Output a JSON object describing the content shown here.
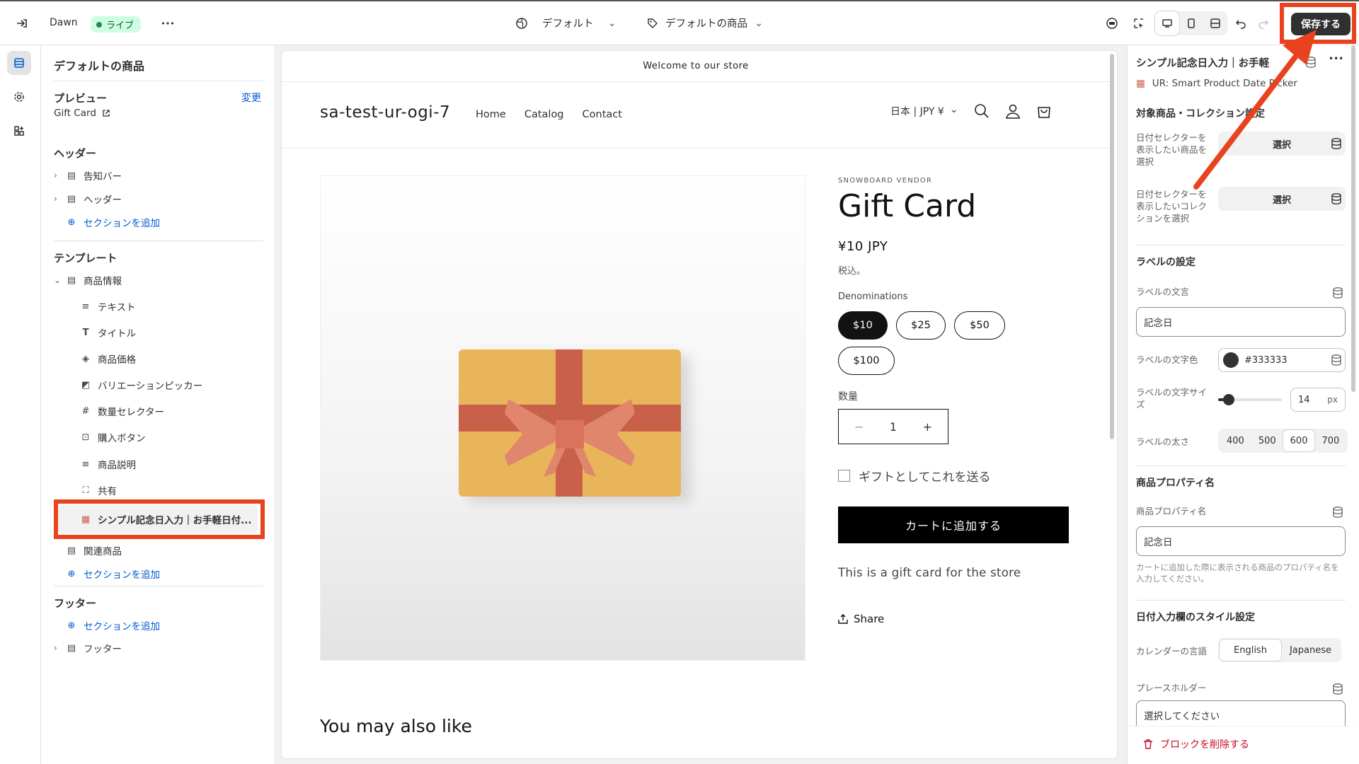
{
  "topbar": {
    "theme_name": "Dawn",
    "live_label": "ライブ",
    "more_label": "•••",
    "center_default_label": "デフォルト",
    "center_product_label": "デフォルトの商品",
    "save_label": "保存する"
  },
  "left": {
    "title": "デフォルトの商品",
    "preview_heading": "プレビュー",
    "preview_change": "変更",
    "preview_value": "Gift Card",
    "header_heading": "ヘッダー",
    "header_items": [
      "告知バー",
      "ヘッダー"
    ],
    "add_section": "セクションを追加",
    "template_heading": "テンプレート",
    "product_info": "商品情報",
    "blocks": [
      "テキスト",
      "タイトル",
      "商品価格",
      "バリエーションピッカー",
      "数量セレクター",
      "購入ボタン",
      "商品説明",
      "共有"
    ],
    "app_block": "シンプル記念日入力｜お手軽日付...",
    "related": "関連商品",
    "footer_heading": "フッター",
    "footer_item": "フッター"
  },
  "store": {
    "announcement": "Welcome to our store",
    "logo": "sa-test-ur-ogi-7",
    "nav": [
      "Home",
      "Catalog",
      "Contact"
    ],
    "locale": "日本 | JPY ¥",
    "vendor": "SNOWBOARD VENDOR",
    "title": "Gift Card",
    "price": "¥10 JPY",
    "tax": "税込。",
    "denominations_label": "Denominations",
    "denominations": [
      "$10",
      "$25",
      "$50",
      "$100"
    ],
    "selected_denomination": "$10",
    "quantity_label": "数量",
    "quantity": "1",
    "gift_checkbox": "ギフトとしてこれを送る",
    "add_to_cart": "カートに追加する",
    "description": "This is a gift card for the store",
    "share": "Share",
    "also_like": "You may also like"
  },
  "right": {
    "title": "シンプル記念日入力｜お手軽",
    "app_name": "UR: Smart Product Date Picker",
    "target_heading": "対象商品・コレクション設定",
    "product_select_label": "日付セレクターを表示したい商品を選択",
    "collection_select_label": "日付セレクターを表示したいコレクションを選択",
    "select_button": "選択",
    "label_heading": "ラベルの設定",
    "label_text_label": "ラベルの文言",
    "label_text_value": "記念日",
    "label_color_label": "ラベルの文字色",
    "label_color_value": "#333333",
    "label_size_label": "ラベルの文字サイズ",
    "label_size_value": "14",
    "label_size_unit": "px",
    "label_size_fraction": 0.1,
    "label_weight_label": "ラベルの太さ",
    "weights": [
      "400",
      "500",
      "600",
      "700"
    ],
    "selected_weight": "600",
    "prop_heading": "商品プロパティ名",
    "prop_label": "商品プロパティ名",
    "prop_value": "記念日",
    "prop_help": "カートに追加した際に表示される商品のプロパティ名を入力してください。",
    "style_heading": "日付入力欄のスタイル設定",
    "calendar_lang_label": "カレンダーの言語",
    "languages": [
      "English",
      "Japanese"
    ],
    "selected_language": "English",
    "placeholder_label": "プレースホルダー",
    "placeholder_value": "選択してください",
    "delete_label": "ブロックを削除する"
  },
  "colors": {
    "highlight": "#e8431e",
    "label_swatch": "#333333",
    "live_bg": "#cdfee1",
    "gift_box": "#e9b55a",
    "ribbon": "#c9604a"
  }
}
